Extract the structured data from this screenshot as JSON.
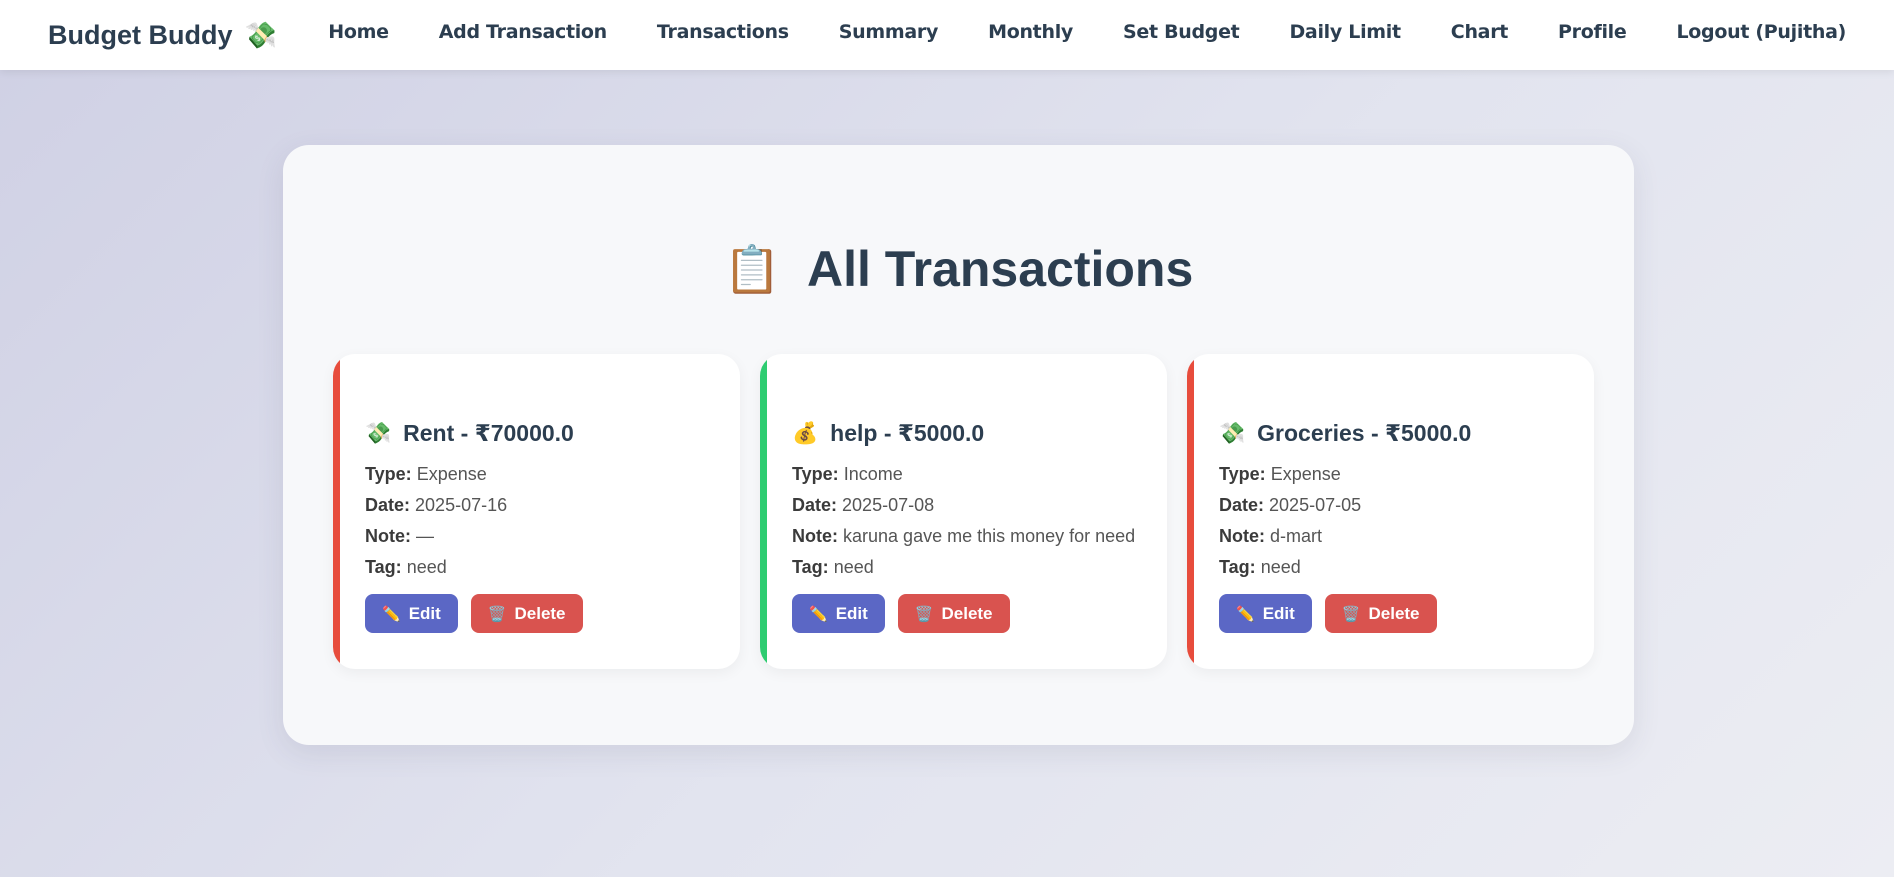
{
  "brand": {
    "name": "Budget Buddy",
    "icon": "💸"
  },
  "nav": {
    "items": [
      {
        "label": "Home"
      },
      {
        "label": "Add Transaction"
      },
      {
        "label": "Transactions"
      },
      {
        "label": "Summary"
      },
      {
        "label": "Monthly"
      },
      {
        "label": "Set Budget"
      },
      {
        "label": "Daily Limit"
      },
      {
        "label": "Chart"
      },
      {
        "label": "Profile"
      },
      {
        "label": "Logout (Pujitha)"
      }
    ]
  },
  "page": {
    "title": "All Transactions",
    "title_icon": "📋"
  },
  "labels": {
    "type": "Type:",
    "date": "Date:",
    "note": "Note:",
    "tag": "Tag:"
  },
  "buttons": {
    "edit": "Edit",
    "delete": "Delete",
    "edit_icon": "✏️",
    "delete_icon": "🗑️"
  },
  "colors": {
    "expense": "#e74c3c",
    "income": "#2ecc71",
    "edit": "#5b67c5",
    "delete": "#d9534f"
  },
  "transactions": [
    {
      "icon": "💸",
      "heading": "Rent - ₹70000.0",
      "type": "Expense",
      "date": "2025-07-16",
      "note": "—",
      "tag": "need"
    },
    {
      "icon": "💰",
      "heading": "help - ₹5000.0",
      "type": "Income",
      "date": "2025-07-08",
      "note": "karuna gave me this money for need",
      "tag": "need"
    },
    {
      "icon": "💸",
      "heading": "Groceries - ₹5000.0",
      "type": "Expense",
      "date": "2025-07-05",
      "note": "d-mart",
      "tag": "need"
    }
  ]
}
